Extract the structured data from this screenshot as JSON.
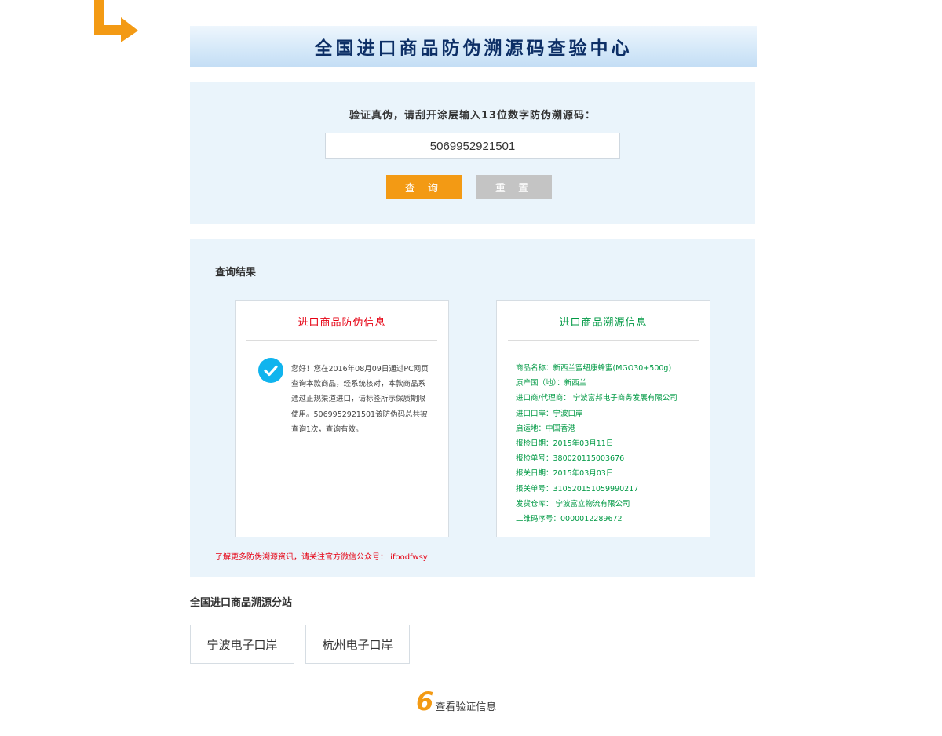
{
  "header": {
    "title": "全国进口商品防伪溯源码查验中心"
  },
  "query": {
    "prompt": "验证真伪，请刮开涂层输入13位数字防伪溯源码：",
    "code_value": "5069952921501",
    "query_label": "查 询",
    "reset_label": "重 置"
  },
  "result": {
    "title": "查询结果",
    "antifake": {
      "title": "进口商品防伪信息",
      "message": "您好！您在2016年08月09日通过PC网页查询本款商品，经系统核对，本款商品系通过正规渠道进口，请标签所示保质期限使用。5069952921501该防伪码总共被查询1次，查询有效。"
    },
    "trace": {
      "title": "进口商品溯源信息",
      "items": [
        "商品名称：新西兰蜜纽康蜂蜜(MGO30+500g)",
        "原产国（地）：新西兰",
        "进口商/代理商： 宁波富邦电子商务发展有限公司",
        "进口口岸：宁波口岸",
        "启运地：中国香港",
        "报检日期：2015年03月11日",
        "报检单号：380020115003676",
        "报关日期：2015年03月03日",
        "报关单号：310520151059990217",
        "发货仓库： 宁波富立物流有限公司",
        "二维码序号：0000012289672"
      ]
    },
    "follow_note": "了解更多防伪溯源资讯，请关注官方微信公众号： ifoodfwsy"
  },
  "substations": {
    "heading": "全国进口商品溯源分站",
    "ningbo": "宁波电子口岸",
    "hangzhou": "杭州电子口岸"
  },
  "step": {
    "number": "6",
    "caption": "查看验证信息"
  },
  "colors": {
    "accent_orange": "#f39a14",
    "panel_bg": "#eaf4fb",
    "title_navy": "#0d2f66",
    "red": "#e60012",
    "green": "#009944",
    "check_blue": "#10b4ee"
  },
  "icons": {
    "corner": "corner-arrow-icon",
    "check": "check-circle-icon"
  }
}
